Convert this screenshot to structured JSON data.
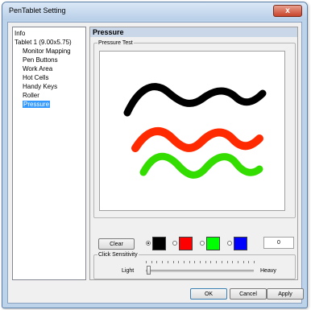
{
  "window": {
    "title": "PenTablet Setting",
    "close_label": "x"
  },
  "tree": {
    "items": [
      {
        "label": "Info"
      },
      {
        "label": "Tablet 1 (9.00x5.75)"
      },
      {
        "label": "Monitor Mapping"
      },
      {
        "label": "Pen Buttons"
      },
      {
        "label": "Work Area"
      },
      {
        "label": "Hot Cells"
      },
      {
        "label": "Handy Keys"
      },
      {
        "label": "Roller"
      },
      {
        "label": "Pressure"
      }
    ],
    "selected": "Pressure"
  },
  "panel": {
    "title": "Pressure",
    "pressure_test_label": "Pressure Test",
    "clear_label": "Clear",
    "colors": [
      "#000000",
      "#ff0000",
      "#00ff00",
      "#0000ff"
    ],
    "selected_color": "#000000",
    "count_value": "0",
    "click_sensitivity_label": "Click Sensitivity",
    "slider_min_label": "Light",
    "slider_max_label": "Heavy",
    "slider_value_fraction": 0.02
  },
  "strokes": [
    {
      "color": "#000000"
    },
    {
      "color": "#ff2a00"
    },
    {
      "color": "#33dd00"
    }
  ],
  "footer": {
    "ok_label": "OK",
    "cancel_label": "Cancel",
    "apply_label": "Apply"
  }
}
